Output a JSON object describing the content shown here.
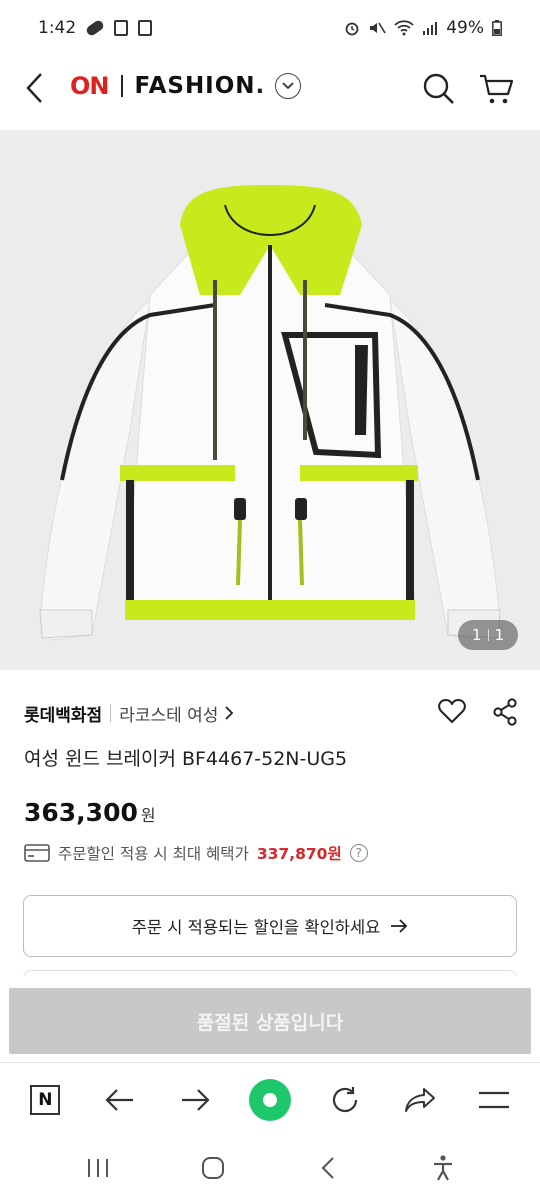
{
  "status_bar": {
    "time": "1:42",
    "battery": "49%"
  },
  "header": {
    "logo_on": "ON",
    "logo_fashion": "FASHION",
    "logo_dot": "."
  },
  "product": {
    "image_counter_current": "1",
    "image_counter_total": "1",
    "store": "롯데백화점",
    "brand": "라코스테 여성",
    "name": "여성 윈드 브레이커 BF4467-52N-UG5",
    "price": "363,300",
    "price_unit": "원",
    "benefit_label": "주문할인 적용 시 최대 혜택가",
    "benefit_amount": "337,870원",
    "coupon_button": "주문 시 적용되는 할인을 확인하세요",
    "soldout_button": "품절된 상품입니다"
  },
  "colors": {
    "accent_red": "#e0201f",
    "benefit_red": "#d8282c",
    "soldout_gray": "#c8c8c8",
    "browser_green": "#1ec86a"
  },
  "icons": [
    "back-icon",
    "chevron-down-icon",
    "search-icon",
    "cart-icon",
    "heart-icon",
    "share-icon",
    "card-icon",
    "help-icon",
    "arrow-right-icon",
    "n-icon",
    "back-arrow-icon",
    "forward-arrow-icon",
    "home-icon",
    "reload-icon",
    "share-arrow-icon",
    "menu-icon",
    "recent-apps-icon",
    "home-circle-icon",
    "sys-back-icon",
    "accessibility-icon"
  ]
}
